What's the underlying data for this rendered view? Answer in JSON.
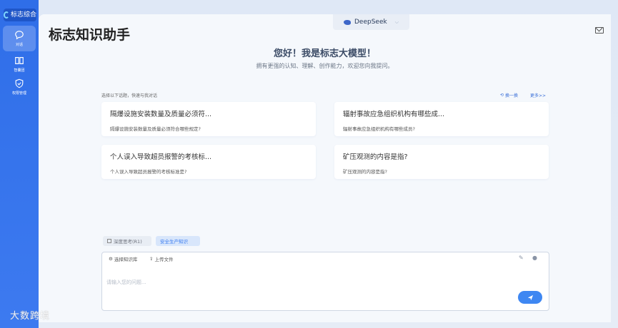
{
  "sidebar": {
    "logo_text": "标志综合",
    "items": [
      {
        "label": "对话",
        "icon": "chat-icon"
      },
      {
        "label": "智囊团",
        "icon": "book-icon"
      },
      {
        "label": "权限管理",
        "icon": "shield-icon"
      }
    ]
  },
  "header": {
    "title": "标志知识助手",
    "model": "DeepSeek",
    "mail_icon": "mail-icon"
  },
  "greeting": {
    "title": "您好！我是标志大模型！",
    "subtitle": "拥有更强的认知、理解、创作能力，欢迎您向我提问。"
  },
  "topics": {
    "label": "选择以下话题，快速与我对话",
    "refresh": "换一换",
    "more": "更多>>",
    "cards": [
      {
        "title": "隔爆设施安装数量及质量必须符...",
        "question": "隔爆设施安装数量及质量必须符合哪些规定?"
      },
      {
        "title": "辐射事故应急组织机构有哪些成...",
        "question": "辐射事故应急组织机构有哪些成员?"
      },
      {
        "title": "个人误入导致超员报警的考核标...",
        "question": "个人误入导致超员报警的考核标准是?"
      },
      {
        "title": "矿压观测的内容是指?",
        "question": "矿压观测的内容是指?"
      }
    ]
  },
  "modes": {
    "deep_think": "深度思考(R1)",
    "safety": "安全生产知识"
  },
  "input": {
    "knowledge_base": "选择知识库",
    "upload": "上传文件",
    "placeholder": "请输入您的问题..."
  },
  "watermark": "大数跨境"
}
